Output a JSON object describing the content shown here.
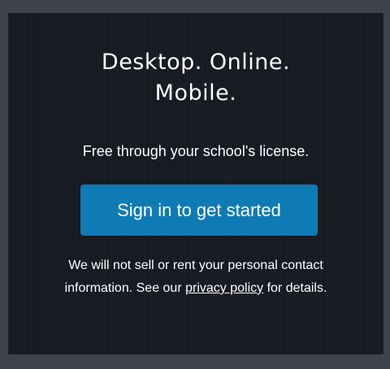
{
  "card": {
    "headline_line1": "Desktop. Online.",
    "headline_line2": "Mobile.",
    "subtext": "Free through your school's license.",
    "cta_label": "Sign in to get started",
    "notice_part1": "We will not sell or rent your personal contact information. See our ",
    "privacy_link": "privacy policy",
    "notice_part2": " for details."
  },
  "colors": {
    "background": "#171b22",
    "frame": "#40434a",
    "button": "#0f7bb5",
    "text": "#ffffff"
  }
}
